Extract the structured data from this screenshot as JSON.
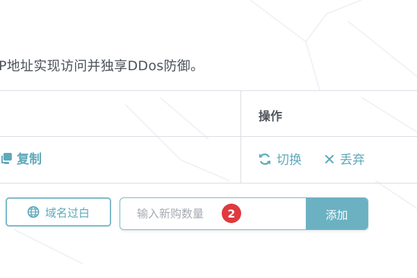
{
  "description": "P地址实现访问并独享DDos防御。",
  "table": {
    "header_ops": "操作",
    "row": {
      "copy_label": "复制",
      "switch_label": "切换",
      "discard_label": "丢弃"
    }
  },
  "actions": {
    "domain_whitelist_label": "域名过白",
    "quantity_placeholder": "输入新购数量",
    "add_label": "添加",
    "step_badge": "2"
  },
  "icons": {
    "copy": "copy-icon",
    "switch": "refresh-icon",
    "discard": "close-icon",
    "domain": "globe-icon"
  },
  "colors": {
    "accent": "#5fa9bb",
    "button_fill": "#6bb1c2",
    "badge": "#e0393e",
    "border": "#d8dde3"
  }
}
